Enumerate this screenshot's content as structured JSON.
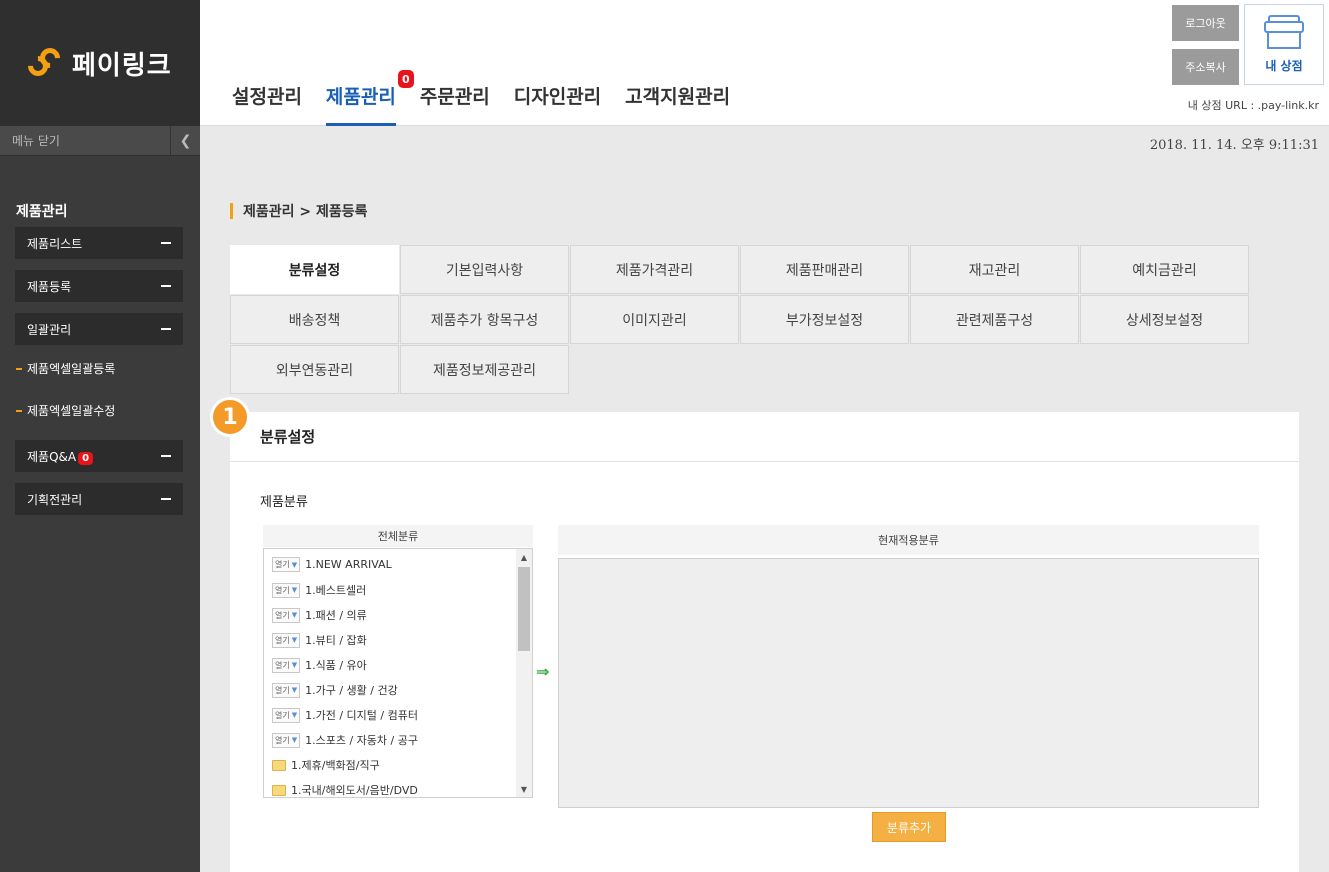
{
  "brand": {
    "name": "페이링크"
  },
  "sidebar": {
    "menu_close": "메뉴 닫기",
    "section_title": "제품관리",
    "items": [
      {
        "label": "제품리스트"
      },
      {
        "label": "제품등록"
      },
      {
        "label": "일괄관리"
      },
      {
        "label": "제품Q&A",
        "badge": "0"
      },
      {
        "label": "기획전관리"
      }
    ],
    "sub_items": [
      {
        "label": "제품엑셀일괄등록"
      },
      {
        "label": "제품엑셀일괄수정"
      }
    ]
  },
  "header": {
    "nav": [
      {
        "label": "설정관리"
      },
      {
        "label": "제품관리",
        "badge": "0",
        "active": true
      },
      {
        "label": "주문관리"
      },
      {
        "label": "디자인관리"
      },
      {
        "label": "고객지원관리"
      }
    ],
    "logout": "로그아웃",
    "copy_address": "주소복사",
    "my_shop": "내 상점",
    "shop_url": "내 상점 URL : .pay-link.kr"
  },
  "datetime": "2018. 11. 14. 오후 9:11:31",
  "breadcrumb": "제품관리 > 제품등록",
  "tabs": [
    {
      "label": "분류설정",
      "active": true
    },
    {
      "label": "기본입력사항"
    },
    {
      "label": "제품가격관리"
    },
    {
      "label": "제품판매관리"
    },
    {
      "label": "재고관리"
    },
    {
      "label": "예치금관리"
    },
    {
      "label": "배송정책"
    },
    {
      "label": "제품추가 항목구성"
    },
    {
      "label": "이미지관리"
    },
    {
      "label": "부가정보설정"
    },
    {
      "label": "관련제품구성"
    },
    {
      "label": "상세정보설정"
    },
    {
      "label": "외부연동관리"
    },
    {
      "label": "제품정보제공관리"
    }
  ],
  "panel": {
    "step": "1",
    "title": "분류설정",
    "section_label": "제품분류",
    "all_categories_header": "전체분류",
    "applied_header": "현재적용분류",
    "open_tag": "열기",
    "categories": [
      {
        "label": "1.NEW ARRIVAL",
        "type": "open"
      },
      {
        "label": "1.베스트셀러",
        "type": "open"
      },
      {
        "label": "1.패션 / 의류",
        "type": "open"
      },
      {
        "label": "1.뷰티 / 잡화",
        "type": "open"
      },
      {
        "label": "1.식품 / 유아",
        "type": "open"
      },
      {
        "label": "1.가구 / 생활 / 건강",
        "type": "open"
      },
      {
        "label": "1.가전 / 디지털 / 컴퓨터",
        "type": "open"
      },
      {
        "label": "1.스포츠 / 자동차 / 공구",
        "type": "open"
      },
      {
        "label": "1.제휴/백화점/직구",
        "type": "folder"
      },
      {
        "label": "1.국내/해외도서/음반/DVD",
        "type": "folder"
      }
    ],
    "add_button": "분류추가"
  },
  "colors": {
    "accent": "#f5a011",
    "brand_blue": "#1a5fb4",
    "badge_red": "#e8141b"
  }
}
